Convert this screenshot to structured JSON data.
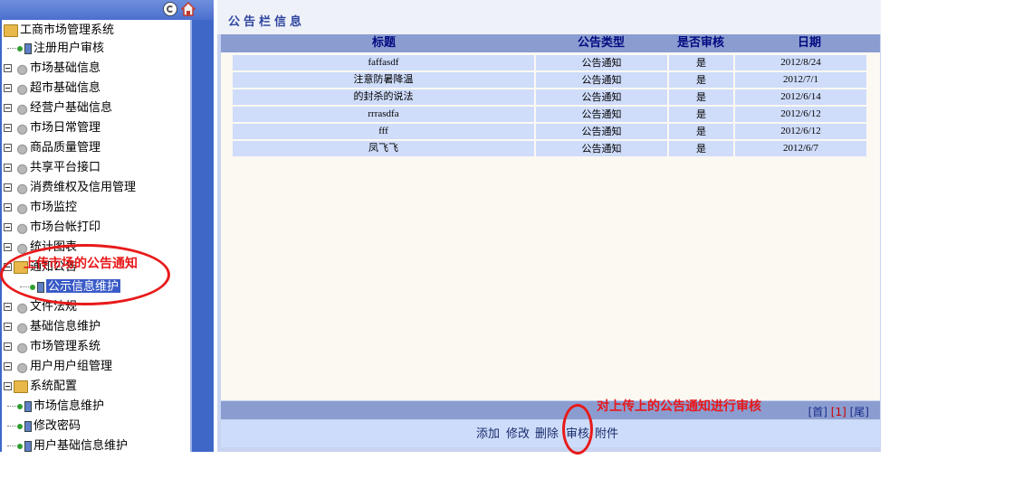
{
  "tree": {
    "root": "工商市场管理系统",
    "nodes": [
      {
        "label": "注册用户审核",
        "type": "leaf"
      },
      {
        "label": "市场基础信息",
        "type": "branch"
      },
      {
        "label": "超市基础信息",
        "type": "branch"
      },
      {
        "label": "经营户基础信息",
        "type": "branch"
      },
      {
        "label": "市场日常管理",
        "type": "branch"
      },
      {
        "label": "商品质量管理",
        "type": "branch"
      },
      {
        "label": "共享平台接口",
        "type": "branch"
      },
      {
        "label": "消费维权及信用管理",
        "type": "branch"
      },
      {
        "label": "市场监控",
        "type": "branch"
      },
      {
        "label": "市场台帐打印",
        "type": "branch"
      },
      {
        "label": "统计图表",
        "type": "branch"
      },
      {
        "label": "通知公告",
        "type": "branch-open"
      },
      {
        "label": "公示信息维护",
        "type": "leaf-selected"
      },
      {
        "label": "文件法规",
        "type": "branch"
      },
      {
        "label": "基础信息维护",
        "type": "branch"
      },
      {
        "label": "市场管理系统",
        "type": "branch"
      },
      {
        "label": "用户用户组管理",
        "type": "branch"
      },
      {
        "label": "系统配置",
        "type": "branch-open"
      },
      {
        "label": "市场信息维护",
        "type": "leaf"
      },
      {
        "label": "修改密码",
        "type": "leaf"
      },
      {
        "label": "用户基础信息维护",
        "type": "leaf"
      }
    ]
  },
  "main": {
    "title": "公告栏信息",
    "columns": [
      "标题",
      "公告类型",
      "是否审核",
      "日期"
    ],
    "rows": [
      [
        "faffasdf",
        "公告通知",
        "是",
        "2012/8/24"
      ],
      [
        "注意防暑降温",
        "公告通知",
        "是",
        "2012/7/1"
      ],
      [
        "的封杀的说法",
        "公告通知",
        "是",
        "2012/6/14"
      ],
      [
        "rrrasdfa",
        "公告通知",
        "是",
        "2012/6/12"
      ],
      [
        "fff",
        "公告通知",
        "是",
        "2012/6/12"
      ],
      [
        "凤飞飞",
        "公告通知",
        "是",
        "2012/6/7"
      ]
    ]
  },
  "pager": {
    "first": "[首]",
    "current": "[1]",
    "last": "[尾]"
  },
  "actions": {
    "add": "添加",
    "edit": "修改",
    "delete": "删除",
    "review": "审核",
    "attach": "附件"
  },
  "annotations": {
    "left_note": "上传市场的公告通知",
    "bottom_note": "对上传上的公告通知进行审核"
  },
  "colors": {
    "annotation": "#e8181a",
    "sidebar": "#3e67c8",
    "header_row": "#8b9dd0",
    "cell": "#cfdcfa"
  }
}
